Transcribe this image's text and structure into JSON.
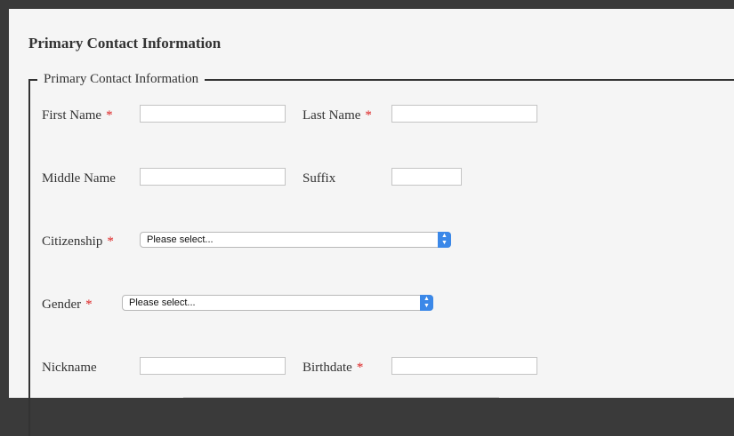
{
  "form": {
    "heading": "Primary Contact Information",
    "legend": "Primary Contact Information",
    "required_mark": "*",
    "fields": {
      "first_name": {
        "label": "First Name",
        "value": ""
      },
      "last_name": {
        "label": "Last Name",
        "value": ""
      },
      "middle_name": {
        "label": "Middle Name",
        "value": ""
      },
      "suffix": {
        "label": "Suffix",
        "value": ""
      },
      "citizenship": {
        "label": "Citizenship",
        "selected": "Please select..."
      },
      "gender": {
        "label": "Gender",
        "selected": "Please select..."
      },
      "nickname": {
        "label": "Nickname",
        "value": ""
      },
      "birthdate": {
        "label": "Birthdate",
        "value": ""
      }
    }
  },
  "icons": {
    "select_arrow": "chevron-up-down-icon"
  },
  "colors": {
    "required": "#dd2222",
    "select_arrow_bg": "#3b88e8"
  }
}
